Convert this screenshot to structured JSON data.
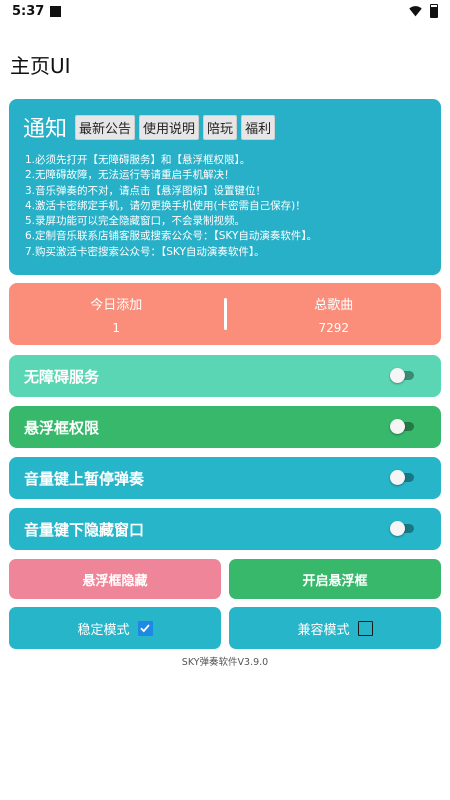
{
  "status_bar": {
    "time": "5:37"
  },
  "app": {
    "title": "主页UI"
  },
  "notice": {
    "title": "通知",
    "tags": [
      "最新公告",
      "使用说明",
      "陪玩",
      "福利"
    ],
    "lines": [
      "1.必须先打开【无障碍服务】和【悬浮框权限】。",
      "2.无障碍故障，无法运行等请重启手机解决！",
      "3.音乐弹奏的不对，请点击【悬浮图标】设置键位！",
      "4.激活卡密绑定手机，请勿更换手机使用(卡密需自己保存)！",
      "5.录屏功能可以完全隐藏窗口，不会录制视频。",
      "6.定制音乐联系店铺客服或搜索公众号：【SKY自动演奏软件】。",
      "7.购买激活卡密搜索公众号：【SKY自动演奏软件】。"
    ],
    "color": "#27b0c8"
  },
  "stats": {
    "today_label": "今日添加",
    "today_value": "1",
    "total_label": "总歌曲",
    "total_value": "7292",
    "color": "#fa8e7b"
  },
  "toggles": [
    {
      "label": "无障碍服务",
      "on": false,
      "color": "#5ad6b4"
    },
    {
      "label": "悬浮框权限",
      "on": false,
      "color": "#37b86a"
    },
    {
      "label": "音量键上暂停弹奏",
      "on": false,
      "color": "#27b5c9"
    },
    {
      "label": "音量键下隐藏窗口",
      "on": false,
      "color": "#27b5c9"
    }
  ],
  "buttons": {
    "hide_float": {
      "label": "悬浮框隐藏",
      "color": "#ef8598"
    },
    "open_float": {
      "label": "开启悬浮框",
      "color": "#37b86a"
    }
  },
  "modes": {
    "stable": {
      "label": "稳定模式",
      "checked": true
    },
    "compatible": {
      "label": "兼容模式",
      "checked": false
    }
  },
  "version": "SKY弹奏软件V3.9.0"
}
